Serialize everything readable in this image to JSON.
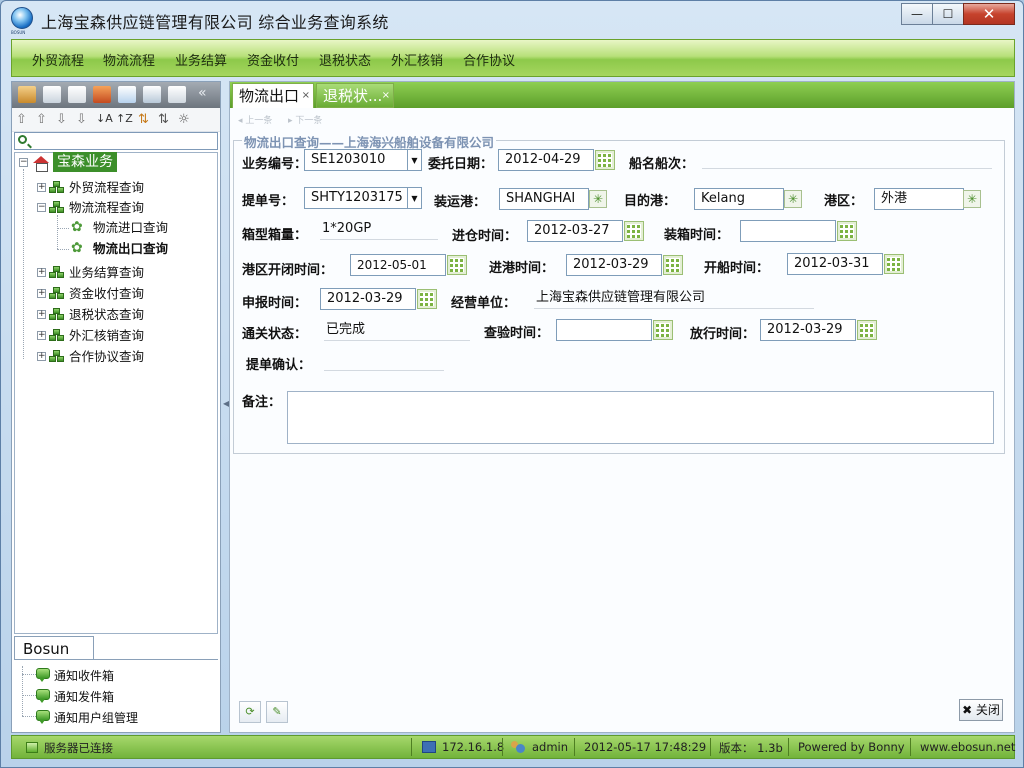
{
  "window": {
    "title": "上海宝森供应链管理有限公司    综合业务查询系统",
    "logo_text": "BOSUN",
    "controls": {
      "minimize": "—",
      "maximize": "☐",
      "close": "✕"
    }
  },
  "menu": [
    "外贸流程",
    "物流流程",
    "业务结算",
    "资金收付",
    "退税状态",
    "外汇核销",
    "合作协议"
  ],
  "sidebar": {
    "toolbar_icons": [
      "users-icon",
      "mail-icon",
      "document-icon",
      "chart-icon",
      "window-icon",
      "windows-icon",
      "home-icon",
      "collapse-icon"
    ],
    "collapse_label": "«",
    "sort_icons": [
      "⇧",
      "⇧",
      "⇩",
      "⇩",
      "↓A",
      "↑Z",
      "⇅",
      "⇅",
      "☼"
    ],
    "search_placeholder": "",
    "tree": {
      "root": "宝森业务",
      "items": [
        {
          "label": "外贸流程查询",
          "level": 1
        },
        {
          "label": "物流流程查询",
          "level": 1
        },
        {
          "label": "物流进口查询",
          "level": 2
        },
        {
          "label": "物流出口查询",
          "level": 2,
          "selected": true
        },
        {
          "label": "业务结算查询",
          "level": 1
        },
        {
          "label": "资金收付查询",
          "level": 1
        },
        {
          "label": "退税状态查询",
          "level": 1
        },
        {
          "label": "外汇核销查询",
          "level": 1
        },
        {
          "label": "合作协议查询",
          "level": 1
        }
      ]
    },
    "bottom_tab": "Bosun",
    "notifications": [
      "通知收件箱",
      "通知发件箱",
      "通知用户组管理"
    ]
  },
  "tabs": [
    {
      "label": "物流出口",
      "close": "×"
    },
    {
      "label": "退税状...",
      "close": "×"
    }
  ],
  "subtoolbar": {
    "prev": "◂ 上一条",
    "next": "▸ 下一条"
  },
  "form": {
    "legend": "物流出口查询——上海海兴船舶设备有限公司",
    "labels": {
      "business_no": "业务编号：",
      "entrust_date": "委托日期：",
      "vessel_voyage": "船名船次：",
      "bill_no": "提单号：",
      "port_loading": "装运港：",
      "port_destination": "目的港：",
      "port_area": "港区：",
      "container_type": "箱型箱量：",
      "warehouse_in": "进仓时间：",
      "loading_time": "装箱时间：",
      "port_close": "港区开闭时间：",
      "port_entry": "进港时间：",
      "sailing": "开船时间：",
      "declare": "申报时间：",
      "operator": "经营单位：",
      "customs_status": "通关状态：",
      "inspection": "查验时间：",
      "release": "放行时间：",
      "bill_confirm": "提单确认：",
      "remarks": "备注："
    },
    "values": {
      "business_no": "SE1203010",
      "entrust_date": "2012-04-29",
      "vessel_voyage": "",
      "bill_no": "SHTY1203175",
      "port_loading": "SHANGHAI",
      "port_destination": "Kelang",
      "port_area": "外港",
      "container_type": "1*20GP",
      "warehouse_in": "2012-03-27",
      "loading_time": "",
      "port_close": "2012-05-01",
      "port_entry": "2012-03-29",
      "sailing": "2012-03-31",
      "declare": "2012-03-29",
      "operator": "上海宝森供应链管理有限公司",
      "customs_status": "已完成",
      "inspection": "",
      "release": "2012-03-29",
      "bill_confirm": "",
      "remarks": ""
    }
  },
  "bottom_buttons": {
    "refresh": "⟳",
    "edit": "✎",
    "close": "✖ 关闭"
  },
  "statusbar": {
    "server": "服务器已连接",
    "ip": "172.16.1.8",
    "user": "admin",
    "datetime": "2012-05-17    17:48:29",
    "version": "版本： 1.3b",
    "powered": "Powered by Bonny",
    "website": "www.ebosun.net"
  }
}
